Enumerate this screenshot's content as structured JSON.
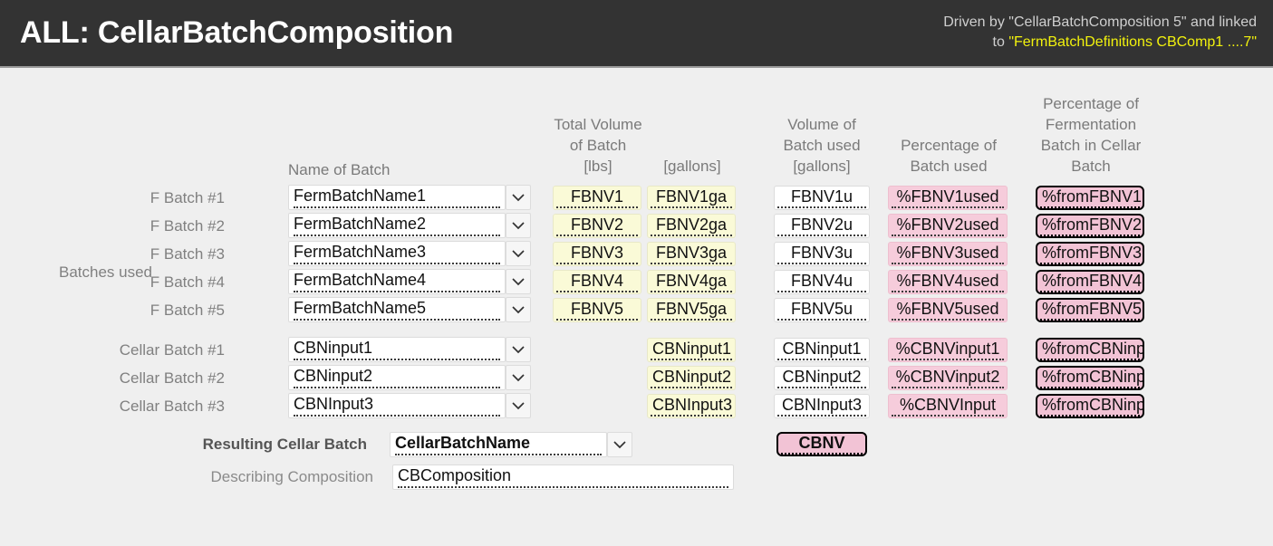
{
  "header": {
    "title": "ALL: CellarBatchComposition",
    "note_line1": "Driven by \"CellarBatchComposition 5\" and linked",
    "note_line2_prefix": "to ",
    "note_line2_highlight": "\"FermBatchDefinitions CBComp1 ....7\"",
    "bar_color": "#333333",
    "highlight_color": "#f2f20d"
  },
  "columns": {
    "name_of_batch": "Name of  Batch",
    "total_volume_lbs": "Total Volume\nof  Batch\n[lbs]",
    "total_volume_gallons": "[gallons]",
    "volume_used": "Volume of\nBatch used\n[gallons]",
    "percentage_used": "Percentage of\nBatch used",
    "percentage_of_ferm": "Percentage of\nFermentation\nBatch in Cellar\nBatch"
  },
  "side_label": "Batches\nused",
  "ferm_rows": [
    {
      "label": "F Batch #1",
      "name": "FermBatchName1",
      "lbs": "FBNV1",
      "gallons": "FBNV1ga",
      "used": "FBNV1u",
      "pct_used": "%FBNV1used",
      "pct_from": "%fromFBNV1"
    },
    {
      "label": "F Batch #2",
      "name": "FermBatchName2",
      "lbs": "FBNV2",
      "gallons": "FBNV2ga",
      "used": "FBNV2u",
      "pct_used": "%FBNV2used",
      "pct_from": "%fromFBNV2"
    },
    {
      "label": "F Batch #3",
      "name": "FermBatchName3",
      "lbs": "FBNV3",
      "gallons": "FBNV3ga",
      "used": "FBNV3u",
      "pct_used": "%FBNV3used",
      "pct_from": "%fromFBNV3"
    },
    {
      "label": "F Batch #4",
      "name": "FermBatchName4",
      "lbs": "FBNV4",
      "gallons": "FBNV4ga",
      "used": "FBNV4u",
      "pct_used": "%FBNV4used",
      "pct_from": "%fromFBNV4"
    },
    {
      "label": "F Batch #5",
      "name": "FermBatchName5",
      "lbs": "FBNV5",
      "gallons": "FBNV5ga",
      "used": "FBNV5u",
      "pct_used": "%FBNV5used",
      "pct_from": "%fromFBNV5"
    }
  ],
  "cellar_rows": [
    {
      "label": "Cellar Batch #1",
      "name": "CBNinput1",
      "lbs": "",
      "gallons": "CBNinput1",
      "used": "CBNinput1",
      "pct_used": "%CBNVinput1",
      "pct_from": "%fromCBNinp"
    },
    {
      "label": "Cellar Batch #2",
      "name": "CBNinput2",
      "lbs": "",
      "gallons": "CBNinput2",
      "used": "CBNinput2",
      "pct_used": "%CBNVinput2",
      "pct_from": "%fromCBNinp"
    },
    {
      "label": "Cellar Batch #3",
      "name": "CBNInput3",
      "lbs": "",
      "gallons": "CBNInput3",
      "used": "CBNInput3",
      "pct_used": "%CBNVInput",
      "pct_from": "%fromCBNinp"
    }
  ],
  "result": {
    "label": "Resulting Cellar Batch",
    "value": "CellarBatchName",
    "volume": "CBNV",
    "composition_label": "Describing Composition",
    "composition_value": "CBComposition"
  },
  "colors": {
    "page_bg": "#efefef",
    "yellow_cell": "#fafad7",
    "pink_soft": "#f6ccdb",
    "pink_bold": "#f2c3d5",
    "label_gray": "#808080"
  },
  "icons": {
    "dropdown": "chevron-down-icon"
  }
}
